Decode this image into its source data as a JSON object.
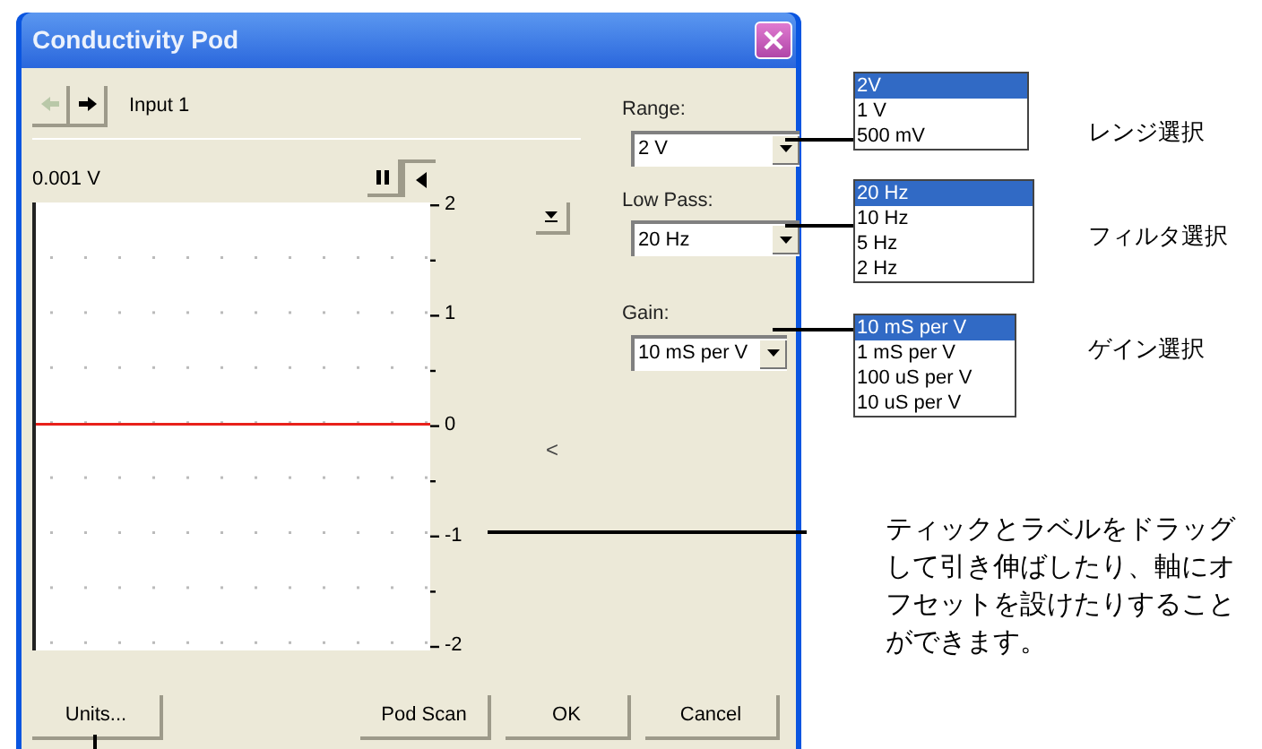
{
  "window": {
    "title": "Conductivity Pod"
  },
  "input": {
    "label": "Input 1"
  },
  "reading": "0.001 V",
  "graph": {
    "tick_labels": [
      "2",
      "1",
      "0",
      "-1",
      "-2"
    ],
    "collapse_mark": "<"
  },
  "settings": [
    {
      "label": "Range:",
      "value": "2 V"
    },
    {
      "label": "Low Pass:",
      "value": "20 Hz"
    },
    {
      "label": "Gain:",
      "value": "10 mS per V"
    }
  ],
  "buttons": [
    "Units...",
    "Pod Scan",
    "OK",
    "Cancel"
  ],
  "callouts": [
    {
      "options": [
        {
          "label": "2V",
          "selected": true
        },
        {
          "label": "1 V",
          "selected": false
        },
        {
          "label": "500 mV",
          "selected": false
        }
      ],
      "caption": "レンジ選択"
    },
    {
      "options": [
        {
          "label": "20 Hz",
          "selected": true
        },
        {
          "label": "10 Hz",
          "selected": false
        },
        {
          "label": "5 Hz",
          "selected": false
        },
        {
          "label": "2 Hz",
          "selected": false
        }
      ],
      "caption": "フィルタ選択"
    },
    {
      "options": [
        {
          "label": "10 mS per V",
          "selected": true
        },
        {
          "label": "1 mS per V",
          "selected": false
        },
        {
          "label": "100 uS per V",
          "selected": false
        },
        {
          "label": "10 uS per V",
          "selected": false
        }
      ],
      "caption": "ゲイン選択"
    }
  ],
  "note": "ティックとラベルをドラッグして引き伸ばしたり、軸にオフセットを設けたりすることができます。"
}
